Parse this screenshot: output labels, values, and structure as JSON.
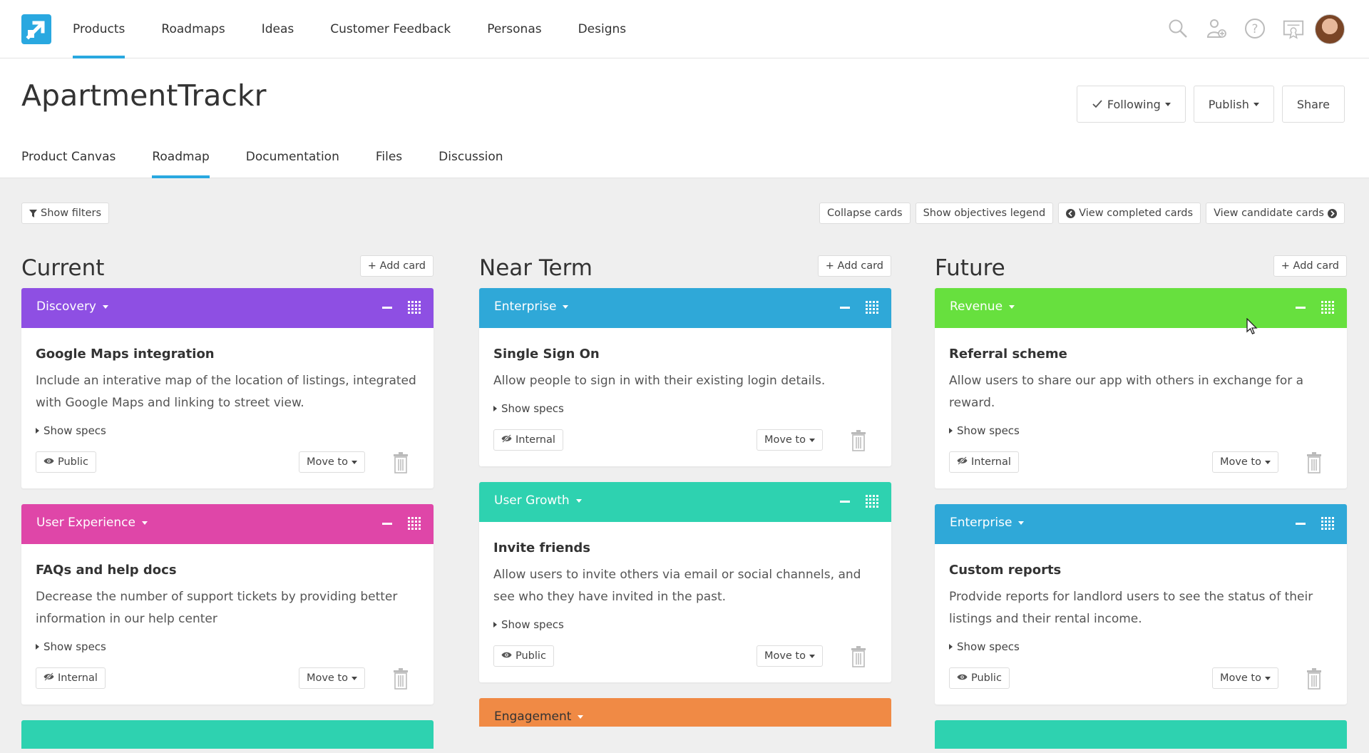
{
  "nav": {
    "items": [
      "Products",
      "Roadmaps",
      "Ideas",
      "Customer Feedback",
      "Personas",
      "Designs"
    ],
    "active": "Products",
    "icons": [
      "search-icon",
      "add-user-icon",
      "help-icon",
      "certificate-icon"
    ]
  },
  "product": {
    "title": "ApartmentTrackr",
    "following_label": "Following",
    "publish_label": "Publish",
    "share_label": "Share",
    "tabs": [
      "Product Canvas",
      "Roadmap",
      "Documentation",
      "Files",
      "Discussion"
    ],
    "active_tab": "Roadmap"
  },
  "toolbar": {
    "show_filters": "Show filters",
    "collapse_cards": "Collapse cards",
    "show_objectives_legend": "Show objectives legend",
    "view_completed_cards": "View completed cards",
    "view_candidate_cards": "View candidate cards"
  },
  "colors": {
    "accent": "#29a8e0",
    "discovery": "#8e4fe3",
    "user_experience": "#df46a8",
    "enterprise": "#2fa8d8",
    "user_growth": "#2ed2b0",
    "revenue": "#67e03e",
    "engagement": "#f08a45"
  },
  "columns": [
    {
      "title": "Current",
      "add_label": "+ Add card",
      "cards": [
        {
          "tag": "Discovery",
          "color": "#8e4fe3",
          "title": "Google Maps integration",
          "description": "Include an interative map of the location of listings, integrated with Google Maps and linking to street view.",
          "specs_label": "Show specs",
          "visibility": "Public",
          "move_label": "Move to"
        },
        {
          "tag": "User Experience",
          "color": "#df46a8",
          "title": "FAQs and help docs",
          "description": "Decrease the number of support tickets by providing better information in our help center",
          "specs_label": "Show specs",
          "visibility": "Internal",
          "move_label": "Move to"
        }
      ],
      "peek": {
        "tag": "",
        "color": "#2ed2b0"
      }
    },
    {
      "title": "Near Term",
      "add_label": "+ Add card",
      "cards": [
        {
          "tag": "Enterprise",
          "color": "#2fa8d8",
          "title": "Single Sign On",
          "description": "Allow people to sign in with their existing login details.",
          "specs_label": "Show specs",
          "visibility": "Internal",
          "move_label": "Move to"
        },
        {
          "tag": "User Growth",
          "color": "#2ed2b0",
          "title": "Invite friends",
          "description": "Allow users to invite others via email or social channels, and see who they have invited in the past.",
          "specs_label": "Show specs",
          "visibility": "Public",
          "move_label": "Move to"
        }
      ],
      "peek": {
        "tag": "Engagement",
        "color": "#f08a45"
      }
    },
    {
      "title": "Future",
      "add_label": "+ Add card",
      "cards": [
        {
          "tag": "Revenue",
          "color": "#67e03e",
          "title": "Referral scheme",
          "description": "Allow users to share our app with others in exchange for a reward.",
          "specs_label": "Show specs",
          "visibility": "Internal",
          "move_label": "Move to"
        },
        {
          "tag": "Enterprise",
          "color": "#2fa8d8",
          "title": "Custom reports",
          "description": "Prodvide reports for landlord users to see the status of their listings and their rental income.",
          "specs_label": "Show specs",
          "visibility": "Public",
          "move_label": "Move to"
        }
      ],
      "peek": {
        "tag": "",
        "color": "#2ed2b0"
      }
    }
  ]
}
